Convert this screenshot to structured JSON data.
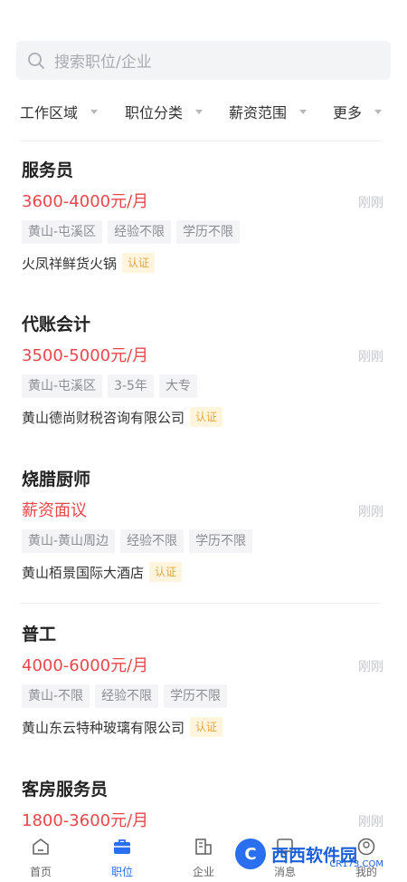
{
  "search": {
    "placeholder": "搜索职位/企业"
  },
  "filters": [
    "工作区域",
    "职位分类",
    "薪资范围",
    "更多"
  ],
  "jobs": [
    {
      "title": "服务员",
      "salary": "3600-4000元/月",
      "time": "刚刚",
      "tags": [
        "黄山-屯溪区",
        "经验不限",
        "学历不限"
      ],
      "company": "火凤祥鲜货火锅",
      "badge": "认证"
    },
    {
      "title": "代账会计",
      "salary": "3500-5000元/月",
      "time": "刚刚",
      "tags": [
        "黄山-屯溪区",
        "3-5年",
        "大专"
      ],
      "company": "黄山德尚财税咨询有限公司",
      "badge": "认证"
    },
    {
      "title": "烧腊厨师",
      "salary": "薪资面议",
      "time": "刚刚",
      "tags": [
        "黄山-黄山周边",
        "经验不限",
        "学历不限"
      ],
      "company": "黄山栢景国际大酒店",
      "badge": "认证"
    },
    {
      "title": "普工",
      "salary": "4000-6000元/月",
      "time": "刚刚",
      "tags": [
        "黄山-不限",
        "经验不限",
        "学历不限"
      ],
      "company": "黄山东云特种玻璃有限公司",
      "badge": "认证"
    },
    {
      "title": "客房服务员",
      "salary": "1800-3600元/月",
      "time": "刚刚"
    }
  ],
  "tabbar": {
    "items": [
      {
        "label": "首页",
        "icon": "home-icon"
      },
      {
        "label": "职位",
        "icon": "briefcase-icon",
        "active": true
      },
      {
        "label": "企业",
        "icon": "building-icon"
      },
      {
        "label": "消息",
        "icon": "message-icon"
      },
      {
        "label": "我的",
        "icon": "user-icon"
      }
    ]
  },
  "watermark": {
    "text": "西西软件园",
    "sub": "CR173.COM"
  },
  "colors": {
    "accent": "#2a6ff0",
    "salary": "#e8474b",
    "badge": "#e8a643"
  }
}
